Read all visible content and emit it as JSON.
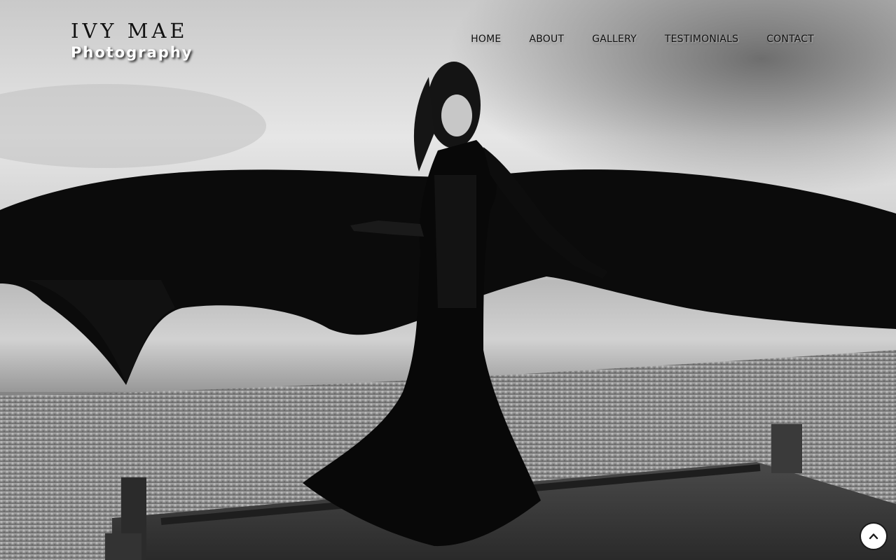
{
  "site": {
    "logo_title": "IVY MAE",
    "logo_subtitle": "Photography"
  },
  "nav": {
    "items": [
      {
        "label": "HOME"
      },
      {
        "label": "ABOUT"
      },
      {
        "label": "GALLERY"
      },
      {
        "label": "TESTIMONIALS"
      },
      {
        "label": "CONTACT"
      }
    ]
  },
  "hero": {
    "image": "black-and-white-photo-woman-in-black-gown-with-flowing-fabric-on-pier"
  },
  "controls": {
    "back_to_top_icon": "chevron-up-icon"
  },
  "colors": {
    "text_dark": "#111111",
    "text_light": "#ffffff"
  }
}
